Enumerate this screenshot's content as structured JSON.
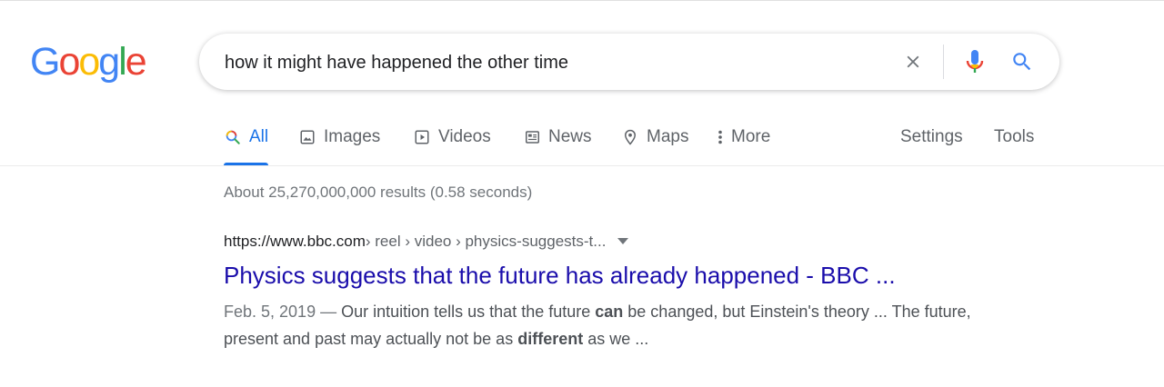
{
  "logo": {
    "letters": [
      {
        "ch": "G",
        "color": "#4285F4"
      },
      {
        "ch": "o",
        "color": "#EA4335"
      },
      {
        "ch": "o",
        "color": "#FBBC05"
      },
      {
        "ch": "g",
        "color": "#4285F4"
      },
      {
        "ch": "l",
        "color": "#34A853"
      },
      {
        "ch": "e",
        "color": "#EA4335"
      }
    ]
  },
  "search": {
    "query": "how it might have happened the other time"
  },
  "tabs": [
    {
      "label": "All",
      "icon": "search-icon",
      "active": true
    },
    {
      "label": "Images",
      "icon": "image-icon"
    },
    {
      "label": "Videos",
      "icon": "video-icon"
    },
    {
      "label": "News",
      "icon": "newspaper-icon"
    },
    {
      "label": "Maps",
      "icon": "map-pin-icon"
    },
    {
      "label": "More",
      "icon": "more-vert-icon"
    }
  ],
  "tools": {
    "settings": "Settings",
    "tools": "Tools"
  },
  "stats": "About 25,270,000,000 results (0.58 seconds)",
  "result": {
    "domain": "https://www.bbc.com",
    "path": " › reel › video › physics-suggests-t...",
    "title": "Physics suggests that the future has already happened - BBC ...",
    "date": "Feb. 5, 2019",
    "dash": " — ",
    "snippet_parts": [
      {
        "text": "Our intuition tells us that the future ",
        "bold": false
      },
      {
        "text": "can",
        "bold": true
      },
      {
        "text": " be changed, but Einstein's theory ... The future, present and past may actually not be as ",
        "bold": false
      },
      {
        "text": "different",
        "bold": true
      },
      {
        "text": " as we ...",
        "bold": false
      }
    ]
  },
  "colors": {
    "accent": "#1a73e8",
    "link": "#1a0dab",
    "muted": "#5f6368"
  }
}
